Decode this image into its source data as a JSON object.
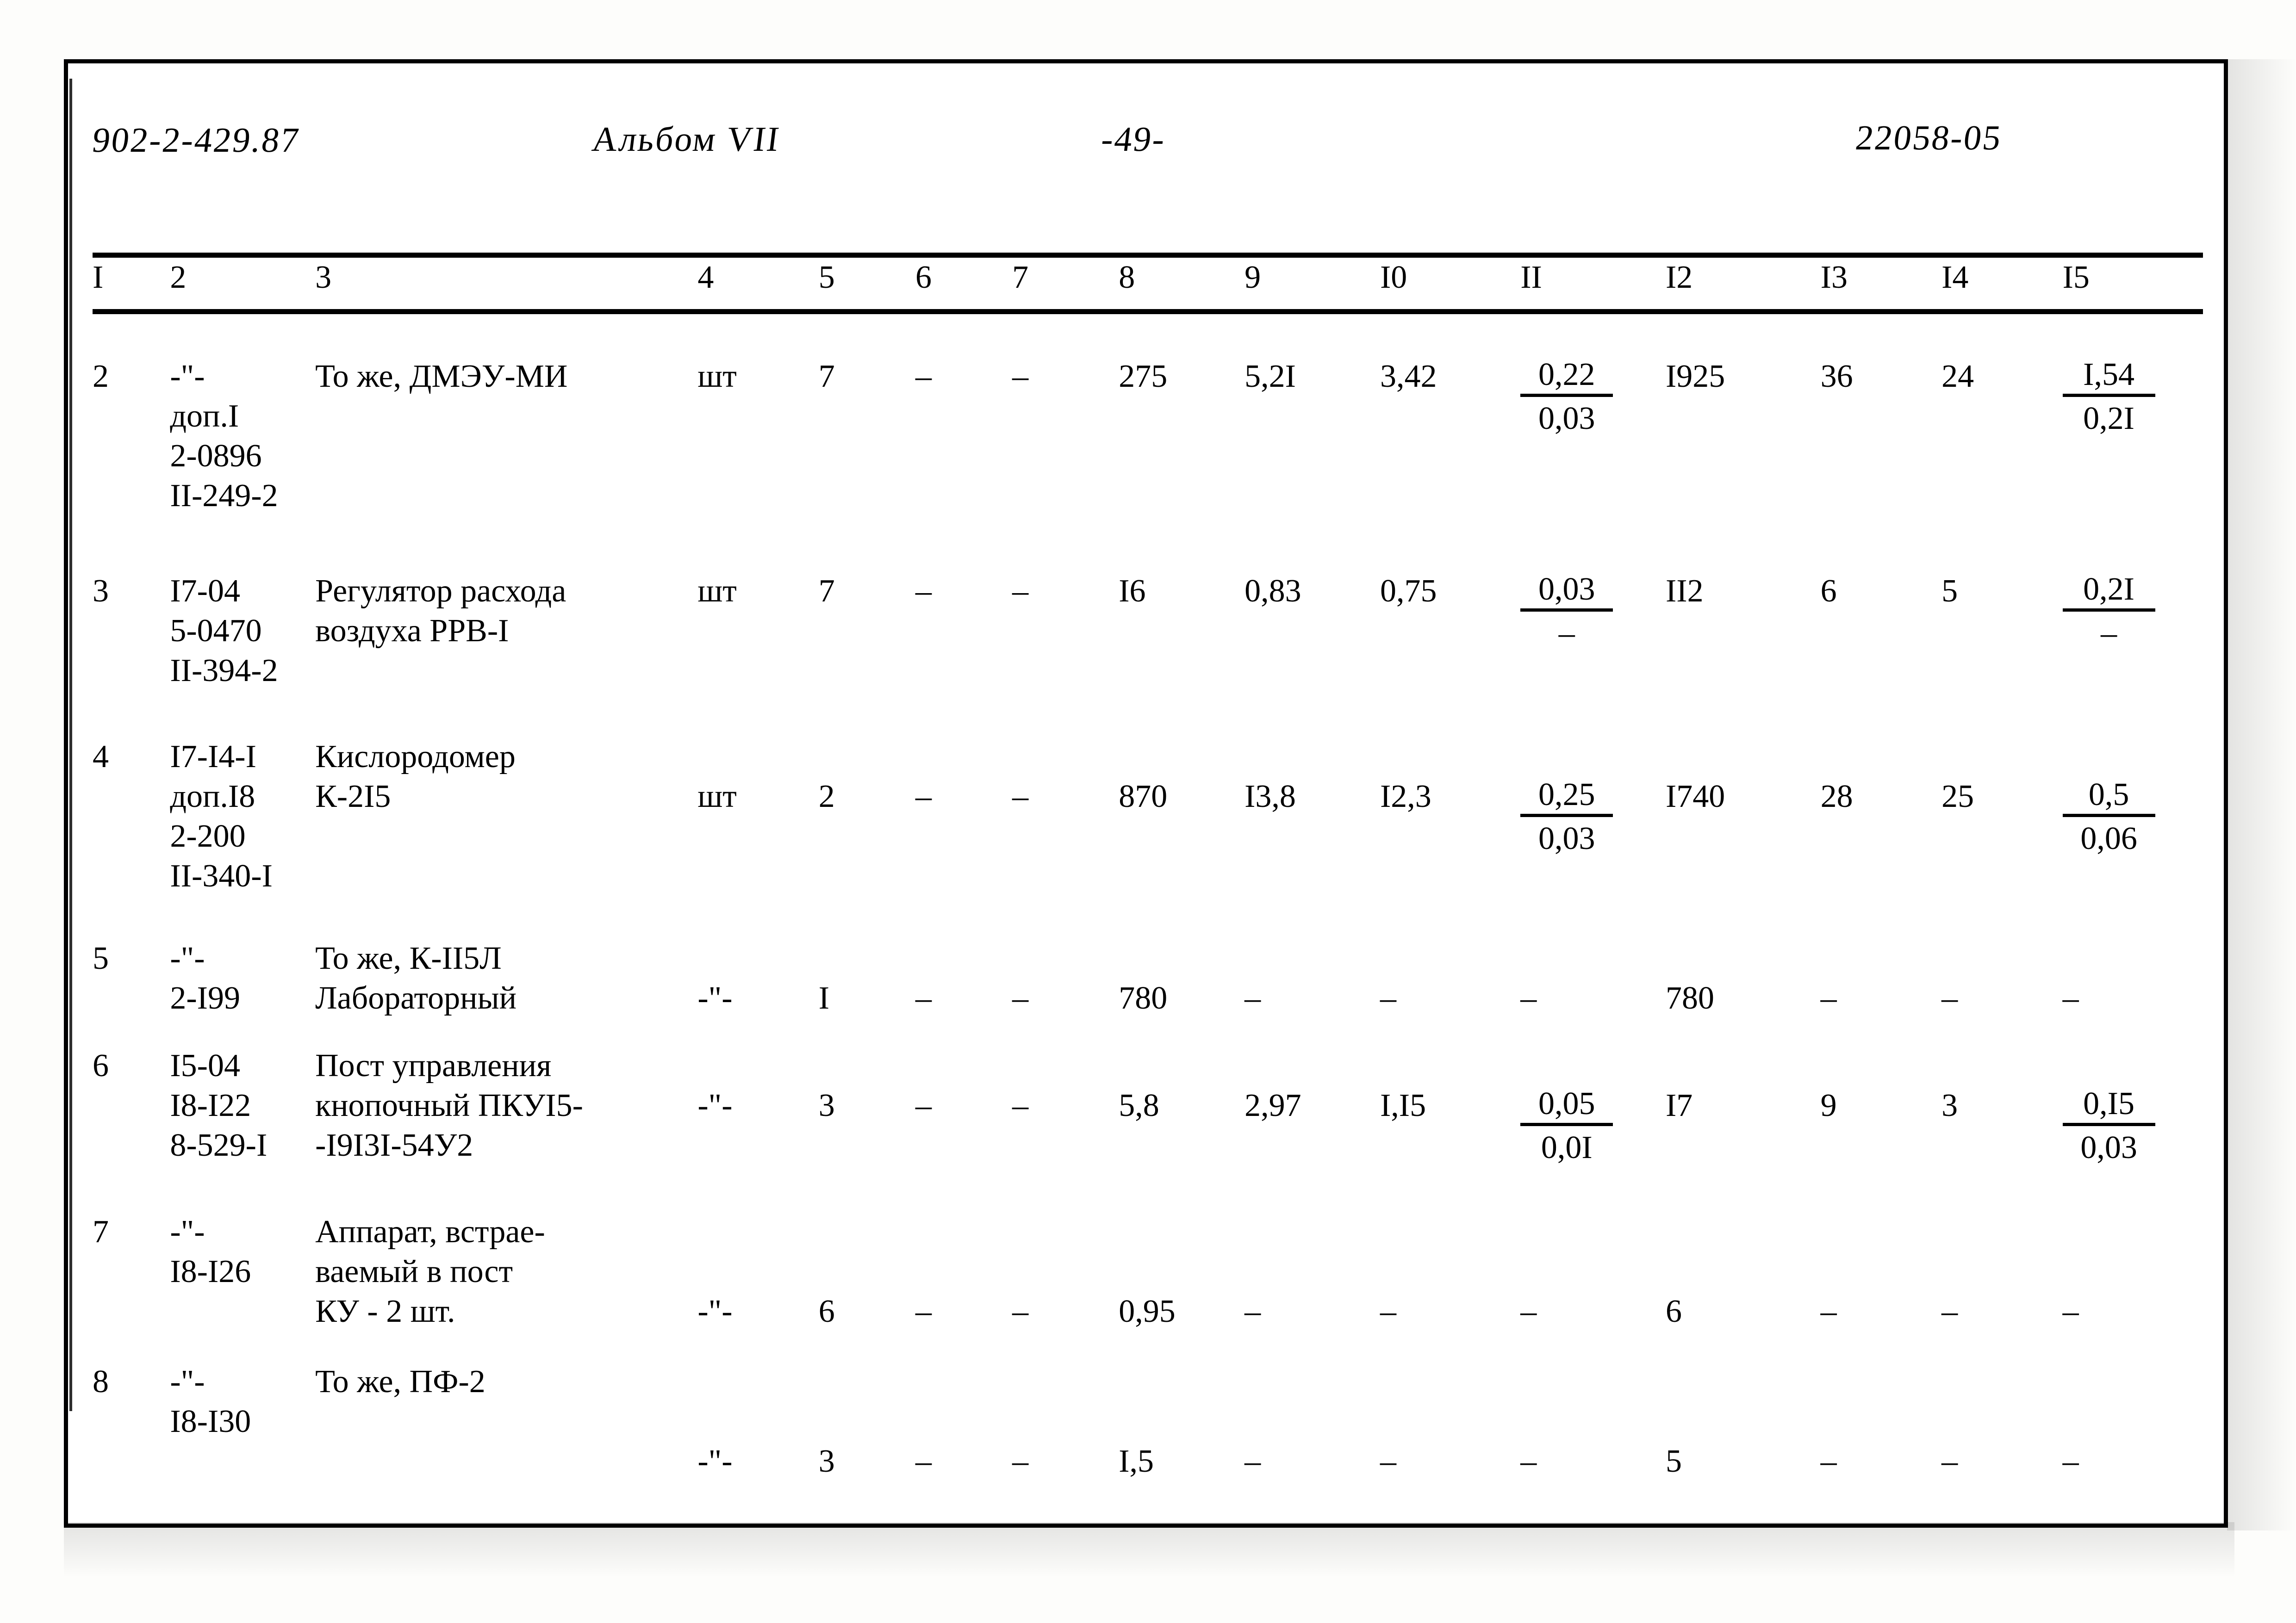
{
  "header": {
    "doc_code": "902-2-429.87",
    "album": "Альбом VII",
    "page": "-49-",
    "order_code": "22058-05"
  },
  "table": {
    "column_headers": [
      "I",
      "2",
      "3",
      "4",
      "5",
      "6",
      "7",
      "8",
      "9",
      "I0",
      "II",
      "I2",
      "I3",
      "I4",
      "I5"
    ],
    "rows": [
      {
        "idx": "2",
        "code": "-\"-\nдоп.I\n2-0896\nII-249-2",
        "name": "То же, ДМЭУ-МИ",
        "unit": "шт",
        "c5": "7",
        "c6": "–",
        "c7": "–",
        "c8": "275",
        "c9": "5,2I",
        "c10": "3,42",
        "c11_top": "0,22",
        "c11_bot": "0,03",
        "c12": "I925",
        "c13": "36",
        "c14": "24",
        "c15_top": "I,54",
        "c15_bot": "0,2I"
      },
      {
        "idx": "3",
        "code": "I7-04\n5-0470\nII-394-2",
        "name": "Регулятор расхода\nвоздуха РРВ-I",
        "unit": "шт",
        "c5": "7",
        "c6": "–",
        "c7": "–",
        "c8": "I6",
        "c9": "0,83",
        "c10": "0,75",
        "c11_top": "0,03",
        "c11_bot": "–",
        "c12": "II2",
        "c13": "6",
        "c14": "5",
        "c15_top": "0,2I",
        "c15_bot": "–"
      },
      {
        "idx": "4",
        "code": "I7-I4-I\nдоп.I8\n2-200\nII-340-I",
        "name": "Кислородомер\nК-2I5",
        "unit": "шт",
        "c5": "2",
        "c6": "–",
        "c7": "–",
        "c8": "870",
        "c9": "I3,8",
        "c10": "I2,3",
        "c11_top": "0,25",
        "c11_bot": "0,03",
        "c12": "I740",
        "c13": "28",
        "c14": "25",
        "c15_top": "0,5",
        "c15_bot": "0,06"
      },
      {
        "idx": "5",
        "code": "-\"-\n2-I99",
        "name": "То же, К-II5Л\nЛабораторный",
        "unit": "-\"-",
        "c5": "I",
        "c6": "–",
        "c7": "–",
        "c8": "780",
        "c9": "–",
        "c10": "–",
        "c11_top": "–",
        "c11_bot": "",
        "c12": "780",
        "c13": "–",
        "c14": "–",
        "c15_top": "–",
        "c15_bot": ""
      },
      {
        "idx": "6",
        "code": "I5-04\nI8-I22\n8-529-I",
        "name": "Пост управления\nкнопочный ПКУI5-\n-I9I3I-54У2",
        "unit": "-\"-",
        "c5": "3",
        "c6": "–",
        "c7": "–",
        "c8": "5,8",
        "c9": "2,97",
        "c10": "I,I5",
        "c11_top": "0,05",
        "c11_bot": "0,0I",
        "c12": "I7",
        "c13": "9",
        "c14": "3",
        "c15_top": "0,I5",
        "c15_bot": "0,03"
      },
      {
        "idx": "7",
        "code": "-\"-\nI8-I26",
        "name": "Аппарат, встрае-\nваемый в пост\nКУ - 2 шт.",
        "unit": "-\"-",
        "c5": "6",
        "c6": "–",
        "c7": "–",
        "c8": "0,95",
        "c9": "–",
        "c10": "–",
        "c11_top": "–",
        "c11_bot": "",
        "c12": "6",
        "c13": "–",
        "c14": "–",
        "c15_top": "–",
        "c15_bot": ""
      },
      {
        "idx": "8",
        "code": "-\"-\nI8-I30",
        "name": "То же, ПФ-2",
        "unit": "-\"-",
        "c5": "3",
        "c6": "–",
        "c7": "–",
        "c8": "I,5",
        "c9": "–",
        "c10": "–",
        "c11_top": "–",
        "c11_bot": "",
        "c12": "5",
        "c13": "–",
        "c14": "–",
        "c15_top": "–",
        "c15_bot": ""
      }
    ]
  }
}
